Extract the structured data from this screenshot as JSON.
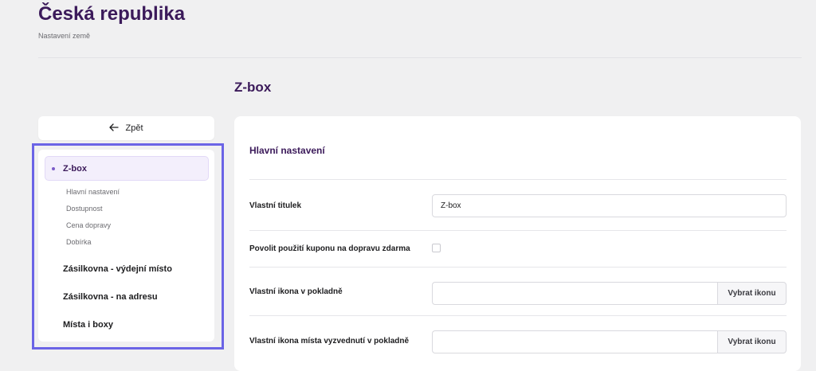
{
  "header": {
    "title": "Česká republika",
    "subtitle": "Nastavení země"
  },
  "section": {
    "title": "Z-box"
  },
  "sidebar": {
    "back_label": "Zpět",
    "back_icon": "arrow-left-icon",
    "active_item": {
      "label": "Z-box"
    },
    "sub_items": [
      {
        "label": "Hlavní nastavení"
      },
      {
        "label": "Dostupnost"
      },
      {
        "label": "Cena dopravy"
      },
      {
        "label": "Dobírka"
      }
    ],
    "items": [
      {
        "label": "Zásilkovna - výdejní místo"
      },
      {
        "label": "Zásilkovna - na adresu"
      },
      {
        "label": "Místa i boxy"
      }
    ],
    "highlight_color": "#6b64e6"
  },
  "main": {
    "heading": "Hlavní nastavení",
    "fields": {
      "title": {
        "label": "Vlastní titulek",
        "value": "Z-box"
      },
      "coupon": {
        "label": "Povolit použití kuponu na dopravu zdarma",
        "checked": false
      },
      "checkout_icon": {
        "label": "Vlastní ikona v pokladně",
        "button_label": "Vybrat ikonu"
      },
      "pickup_icon": {
        "label": "Vlastní ikona místa vyzvednutí v pokladně",
        "button_label": "Vybrat ikonu"
      }
    }
  },
  "colors": {
    "accent": "#3b1a5a",
    "background": "#f0f0f1"
  }
}
